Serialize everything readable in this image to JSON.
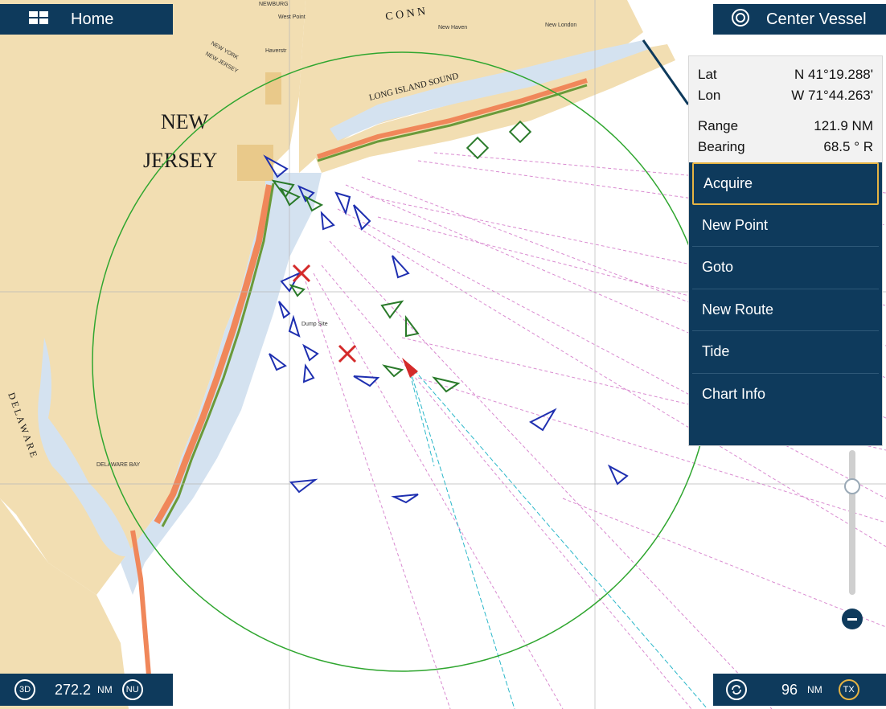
{
  "top_left": {
    "icon": "layout-grid-icon",
    "label": "Home"
  },
  "top_right": {
    "icon": "target-icon",
    "label": "Center Vessel"
  },
  "info": {
    "lat_label": "Lat",
    "lat_value": "N 41°19.288'",
    "lon_label": "Lon",
    "lon_value": "W 71°44.263'",
    "range_label": "Range",
    "range_value": "121.9 NM",
    "bearing_label": "Bearing",
    "bearing_value": "68.5 ° R"
  },
  "menu": [
    "Acquire",
    "New Point",
    "Goto",
    "New Route",
    "Tide",
    "Chart Info"
  ],
  "menu_selected": "Acquire",
  "bottom_left": {
    "mode_3d": "3D",
    "range": "272.2",
    "unit": "NM",
    "orientation": "NU"
  },
  "bottom_right": {
    "icon": "refresh-icon",
    "range": "96",
    "unit": "NM",
    "tx": "TX"
  },
  "chart_labels": {
    "new_jersey_1": "NEW",
    "new_jersey_2": "JERSEY",
    "long_island_sound": "LONG ISLAND SOUND",
    "conn": "C O N N",
    "new_york": "NEW YORK",
    "new_jersey_small": "NEW JERSEY",
    "new_haven": "New Haven",
    "new_london": "New London",
    "delaware_bay": "DELAWARE BAY",
    "delaware": "D E L A W A R E",
    "dump_site": "Dump Site",
    "west_point": "West Point",
    "haverstr": "Haverstr",
    "newburg": "NEWBURG"
  },
  "colors": {
    "panel": "#0e3a5c",
    "accent": "#e5b343",
    "range_ring": "#2fa62f",
    "land": "#f2deb2",
    "water": "#ffffff",
    "shallow": "#d4e2f0",
    "traffic": "#d98ad0"
  }
}
